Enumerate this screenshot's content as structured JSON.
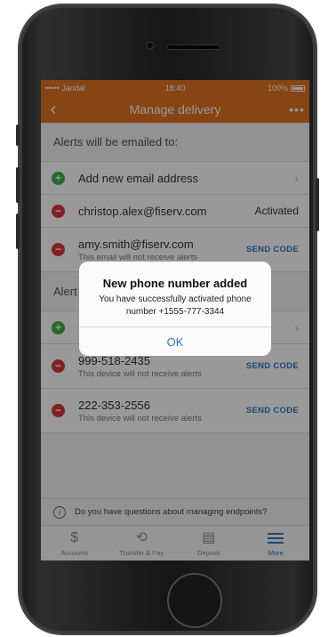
{
  "status": {
    "carrier": "••••• Jandal",
    "time": "18:40",
    "battery": "100%"
  },
  "nav": {
    "back_icon": "‹",
    "title": "Manage delivery",
    "more_icon": "•••"
  },
  "email_section": {
    "header": "Alerts will be emailed to:",
    "add_label": "Add new email address",
    "items": [
      {
        "address": "christop.alex@fiserv.com",
        "status": "Activated"
      },
      {
        "address": "amy.smith@fiserv.com",
        "note": "This email will not receive alerts",
        "action": "SEND CODE"
      }
    ]
  },
  "phone_section": {
    "header": "Alert",
    "items": [
      {
        "number": "999-518-2435",
        "note": "This device will not receive alerts",
        "action": "SEND CODE"
      },
      {
        "number": "222-353-2556",
        "note": "This device will not receive alerts",
        "action": "SEND CODE"
      }
    ]
  },
  "help": {
    "text": "Do you have questions about managing endpoints?"
  },
  "tabs": [
    {
      "label": "Accounts",
      "icon": "dollar-icon"
    },
    {
      "label": "Transfer & Pay",
      "icon": "transfer-icon"
    },
    {
      "label": "Deposit",
      "icon": "deposit-icon"
    },
    {
      "label": "More",
      "icon": "menu-icon"
    }
  ],
  "dialog": {
    "title": "New phone number added",
    "message": "You have successfully activated phone number +1555-777-3344",
    "button": "OK"
  },
  "colors": {
    "brand": "#e07321",
    "link": "#2f78c5",
    "add": "#3fae49",
    "remove": "#d9363e"
  }
}
